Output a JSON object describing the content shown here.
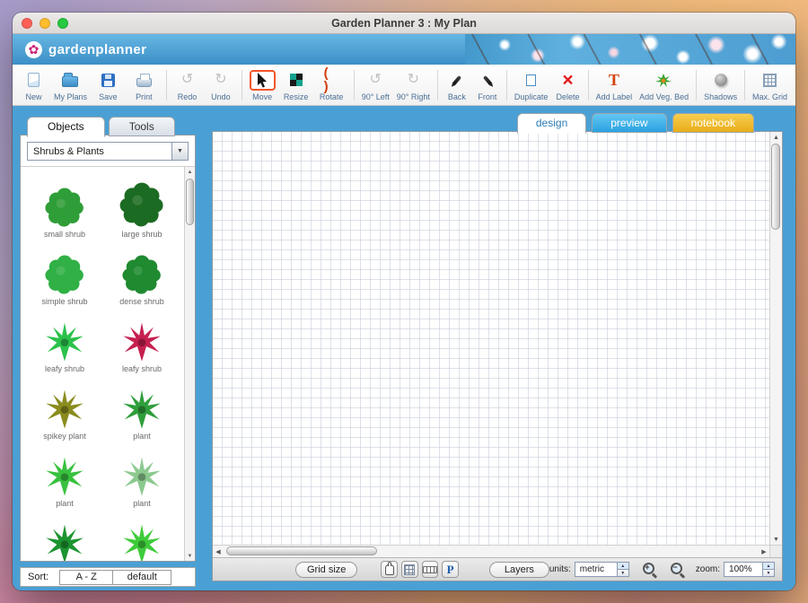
{
  "window": {
    "title": "Garden Planner 3 : My Plan"
  },
  "header": {
    "logo": "gardenplanner"
  },
  "toolbar": {
    "items": [
      {
        "label": "New",
        "icon": "new-document-icon"
      },
      {
        "label": "My Plans",
        "icon": "folder-icon"
      },
      {
        "label": "Save",
        "icon": "floppy-disk-icon"
      },
      {
        "label": "Print",
        "icon": "printer-icon"
      },
      {
        "label": "Redo",
        "icon": "redo-arrow-icon"
      },
      {
        "label": "Undo",
        "icon": "undo-arrow-icon"
      },
      {
        "label": "Move",
        "icon": "cursor-arrow-icon",
        "active": true
      },
      {
        "label": "Resize",
        "icon": "resize-squares-icon"
      },
      {
        "label": "Rotate",
        "icon": "rotate-arrows-icon"
      },
      {
        "label": "90° Left",
        "icon": "rotate-left-icon"
      },
      {
        "label": "90° Right",
        "icon": "rotate-right-icon"
      },
      {
        "label": "Back",
        "icon": "send-back-pen-icon"
      },
      {
        "label": "Front",
        "icon": "bring-front-pen-icon"
      },
      {
        "label": "Duplicate",
        "icon": "duplicate-pages-icon"
      },
      {
        "label": "Delete",
        "icon": "red-x-icon"
      },
      {
        "label": "Add Label",
        "icon": "text-t-icon"
      },
      {
        "label": "Add Veg. Bed",
        "icon": "vegetable-icon"
      },
      {
        "label": "Shadows",
        "icon": "shadow-sphere-icon"
      },
      {
        "label": "Max. Grid",
        "icon": "grid-icon"
      }
    ]
  },
  "sidebar": {
    "tab_objects": "Objects",
    "tab_tools": "Tools",
    "category": "Shrubs & Plants",
    "plants": [
      {
        "label": "small shrub",
        "color": "#2f9e38",
        "shape": "blob"
      },
      {
        "label": "large shrub",
        "color": "#1c6b22",
        "shape": "blob"
      },
      {
        "label": "simple shrub",
        "color": "#30b045",
        "shape": "blob"
      },
      {
        "label": "dense shrub",
        "color": "#1f8a30",
        "shape": "blob"
      },
      {
        "label": "leafy shrub",
        "color": "#2cc14c",
        "shape": "star"
      },
      {
        "label": "leafy shrub",
        "color": "#c6204f",
        "shape": "star"
      },
      {
        "label": "spikey plant",
        "color": "#8a8c1e",
        "shape": "star"
      },
      {
        "label": "plant",
        "color": "#2f9e3c",
        "shape": "star"
      },
      {
        "label": "plant",
        "color": "#38c13e",
        "shape": "star"
      },
      {
        "label": "plant",
        "color": "#8cc98f",
        "shape": "star"
      },
      {
        "label": "",
        "color": "#1d9430",
        "shape": "star"
      },
      {
        "label": "",
        "color": "#3ecb3a",
        "shape": "star"
      }
    ],
    "sort_label": "Sort:",
    "sort_az": "A - Z",
    "sort_default": "default"
  },
  "canvas": {
    "tab_design": "design",
    "tab_preview": "preview",
    "tab_notebook": "notebook"
  },
  "bottombar": {
    "grid_size": "Grid size",
    "p": "P",
    "layers": "Layers",
    "units_label": "units:",
    "units_value": "metric",
    "zoom_label": "zoom:",
    "zoom_value": "100%"
  },
  "colors": {
    "accent-blue": "#4aa0d4",
    "header-blue-1": "#66b6e4",
    "header-blue-2": "#3c90c6",
    "tab-preview-1": "#64c6f2",
    "tab-preview-2": "#2aa2e0",
    "tab-notebook-1": "#f6ce4e",
    "tab-notebook-2": "#e9ad1a",
    "active-tool": "#f4552a",
    "traffic-red": "#ff5f57",
    "traffic-yellow": "#febc2e",
    "traffic-green": "#28c840",
    "toolbar-label": "#4a6f95"
  }
}
